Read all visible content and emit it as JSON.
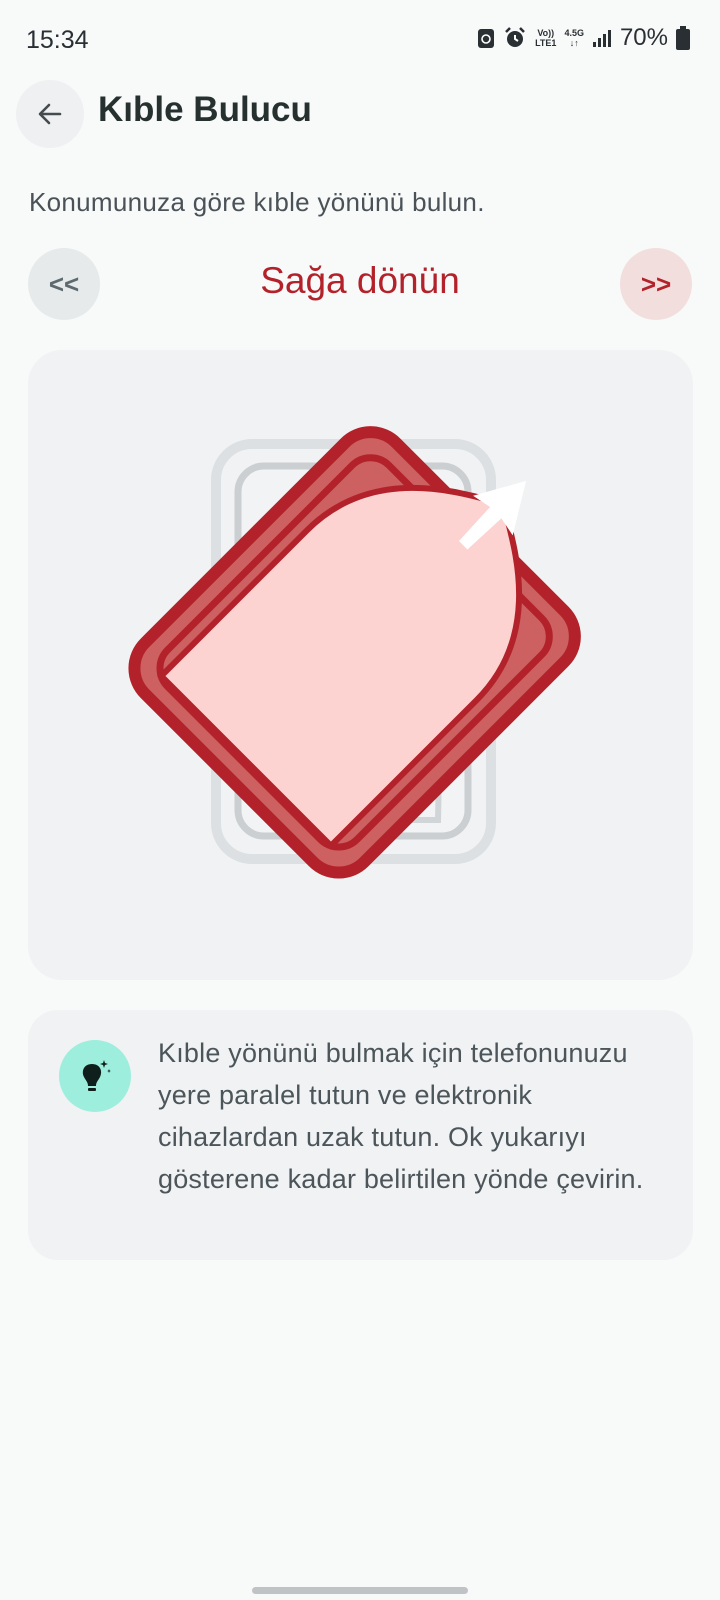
{
  "status": {
    "time": "15:34",
    "volte_top": "Vo))",
    "volte_bottom": "LTE1",
    "network": "4.5G",
    "battery": "70%"
  },
  "header": {
    "title": "Kıble Bulucu"
  },
  "subtitle": "Konumunuza göre kıble yönünü bulun.",
  "direction": {
    "left_label": "<<",
    "right_label": ">>",
    "instruction": "Sağa dönün"
  },
  "tip": {
    "text": "Kıble yönünü bulmak için telefonunuzu yere paralel tutun ve elektronik cihazlardan uzak tutun. Ok yukarıyı gösterene kadar belirtilen yönde çevirin."
  },
  "colors": {
    "accent": "#b3222a",
    "tip_icon_bg": "#9eeedd",
    "card_bg": "#f0f2f3"
  }
}
